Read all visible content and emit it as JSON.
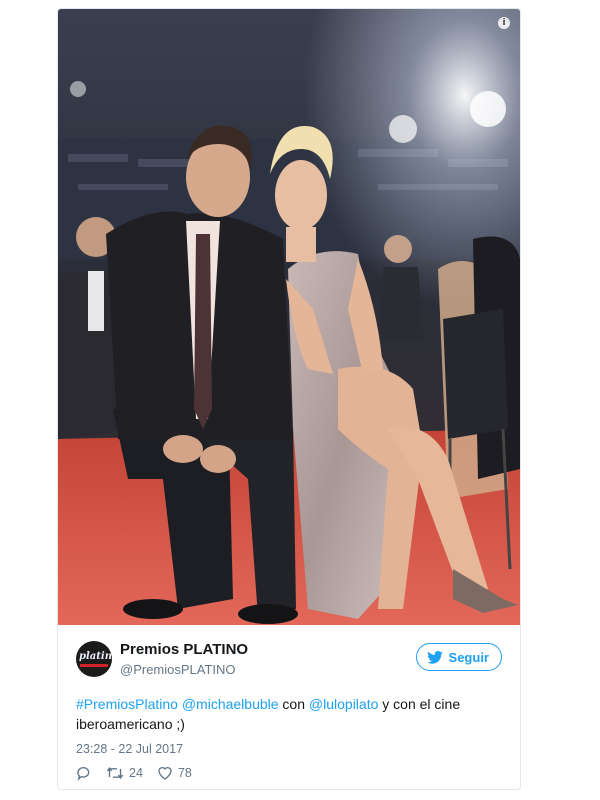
{
  "photo": {
    "alt_icon": "info-icon",
    "colors": {
      "carpet": "#cf4a3c",
      "suit": "#1f1f24",
      "dress": "#b9a8a6"
    }
  },
  "author": {
    "display_name": "Premios PLATINO",
    "handle": "@PremiosPLATINO",
    "avatar_text": "platino"
  },
  "follow_button": {
    "label": "Seguir",
    "icon": "twitter-bird-icon"
  },
  "tweet": {
    "parts": [
      {
        "text": "#PremiosPlatino",
        "type": "hashtag"
      },
      {
        "text": " ",
        "type": "text"
      },
      {
        "text": "@michaelbuble",
        "type": "mention"
      },
      {
        "text": " con ",
        "type": "text"
      },
      {
        "text": "@lulopilato",
        "type": "mention"
      },
      {
        "text": " y con el cine iberoamericano ;)",
        "type": "text"
      }
    ],
    "timestamp": "23:28 - 22 Jul 2017"
  },
  "actions": {
    "reply_icon": "reply-icon",
    "retweet_icon": "retweet-icon",
    "retweet_count": "24",
    "like_icon": "heart-icon",
    "like_count": "78"
  },
  "colors": {
    "accent": "#1da1f2",
    "text": "#14171a",
    "muted": "#657786"
  }
}
